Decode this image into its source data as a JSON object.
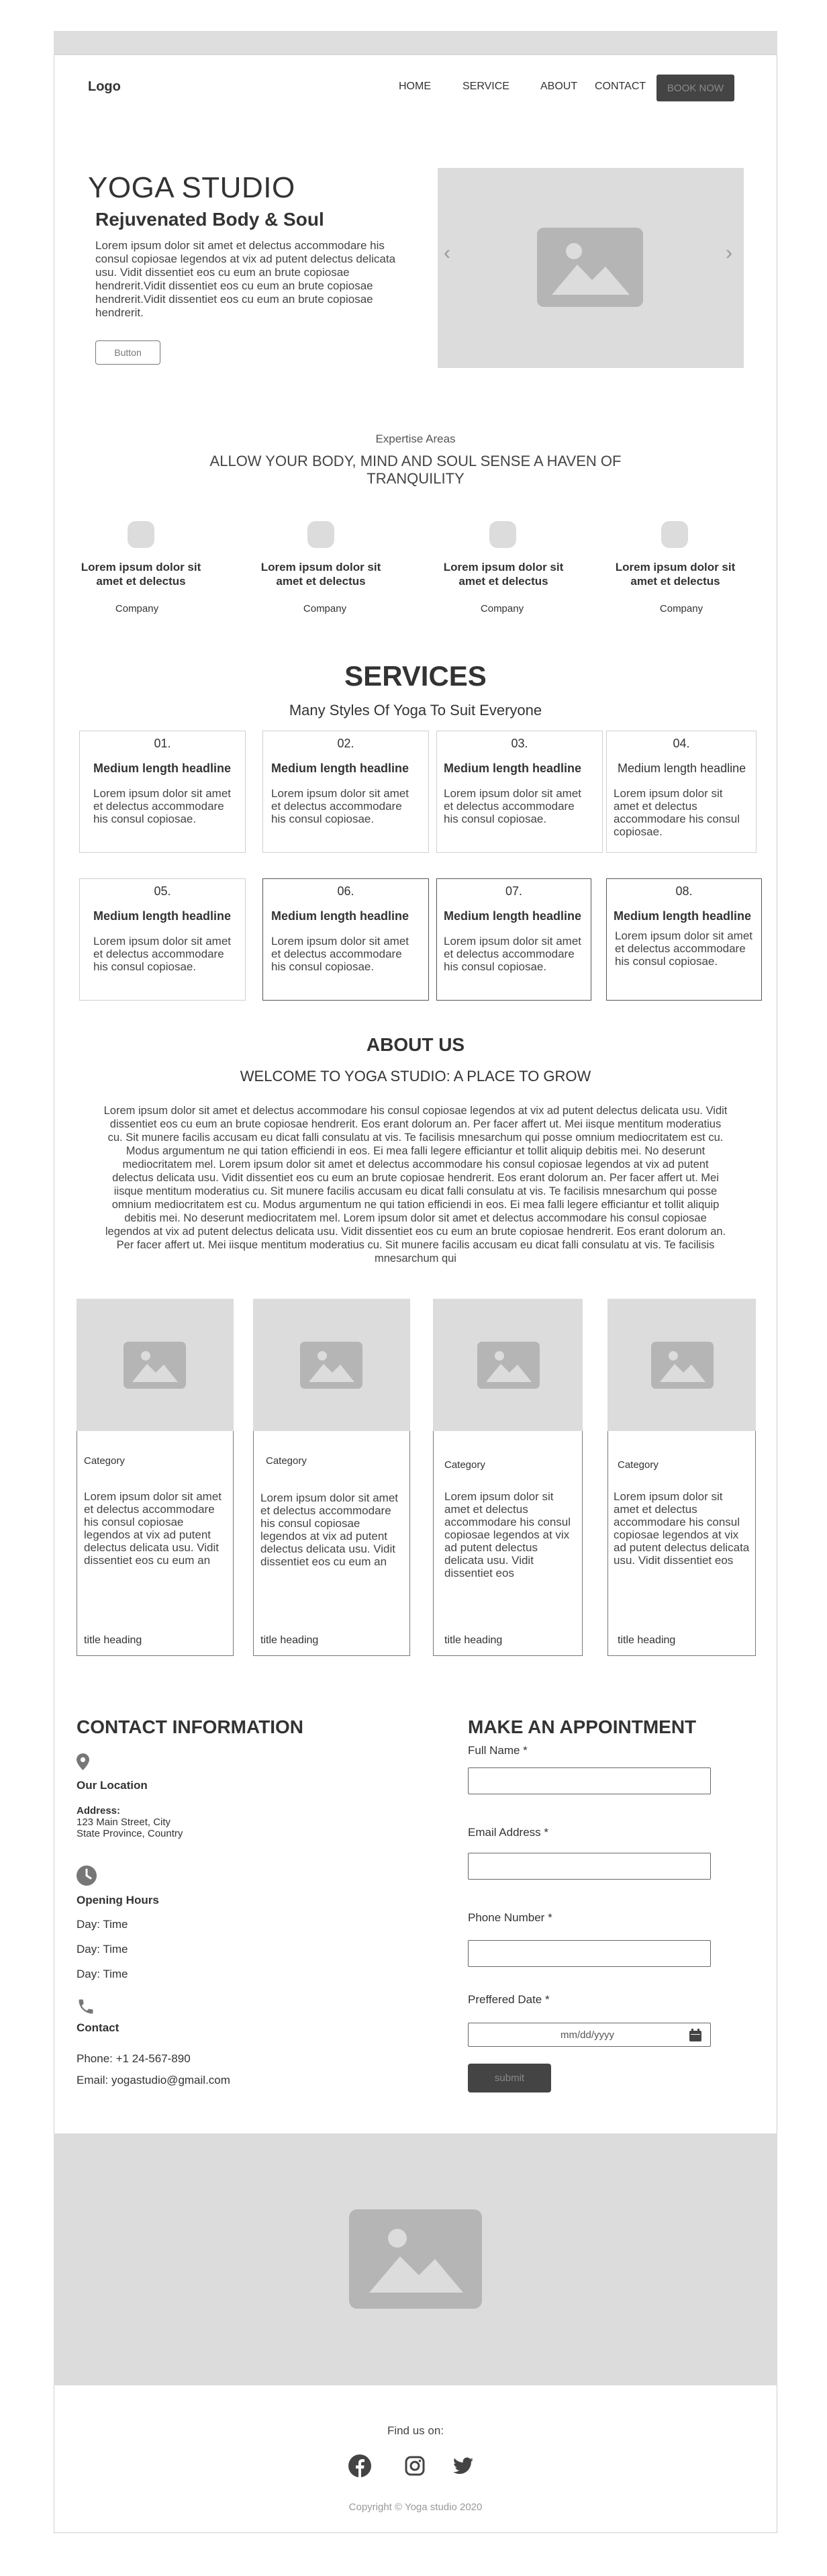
{
  "colors": {
    "placeholder_bg": "#dcdcdc",
    "placeholder_icon": "#b5b5b5",
    "button_dark": "#444444",
    "border": "#cfcfcf"
  },
  "nav": {
    "logo": "Logo",
    "items": [
      "HOME",
      "SERVICE",
      "ABOUT",
      "CONTACT"
    ],
    "cta": "BOOK NOW"
  },
  "hero": {
    "title": "YOGA STUDIO",
    "subtitle": "Rejuvenated Body & Soul",
    "text": "Lorem ipsum dolor sit amet et delectus accommodare his consul copiosae legendos at vix ad putent delectus delicata usu. Vidit dissentiet eos cu eum an brute copiosae hendrerit.Vidit dissentiet eos cu eum an brute copiosae hendrerit.Vidit dissentiet eos cu eum an brute copiosae hendrerit.",
    "button": "Button",
    "image_icon": "image-placeholder-icon",
    "prev_icon": "chevron-left-icon",
    "next_icon": "chevron-right-icon"
  },
  "expertise": {
    "kicker": "Expertise Areas",
    "title": "ALLOW YOUR BODY, MIND AND SOUL SENSE A HAVEN OF TRANQUILITY",
    "items": [
      {
        "label": "Lorem ipsum dolor sit amet et delectus",
        "company": "Company"
      },
      {
        "label": "Lorem ipsum dolor sit amet et delectus",
        "company": "Company"
      },
      {
        "label": "Lorem ipsum dolor sit amet et delectus",
        "company": "Company"
      },
      {
        "label": "Lorem ipsum dolor sit amet et delectus",
        "company": "Company"
      }
    ]
  },
  "services": {
    "title": "SERVICES",
    "subtitle": "Many Styles Of Yoga To Suit Everyone",
    "cards": [
      {
        "num": "01.",
        "heading": "Medium length headline",
        "text": "Lorem ipsum dolor sit amet et delectus accommodare his consul copiosae."
      },
      {
        "num": "02.",
        "heading": "Medium length headline",
        "text": "Lorem ipsum dolor sit amet et delectus accommodare his consul copiosae."
      },
      {
        "num": "03.",
        "heading": "Medium length headline",
        "text": "Lorem ipsum dolor sit amet et delectus accommodare his consul copiosae."
      },
      {
        "num": "04.",
        "heading": "Medium length headline",
        "text": "Lorem ipsum dolor sit amet et delectus accommodare his consul copiosae."
      },
      {
        "num": "05.",
        "heading": "Medium length headline",
        "text": "Lorem ipsum dolor sit amet et delectus accommodare his consul copiosae."
      },
      {
        "num": "06.",
        "heading": "Medium length headline",
        "text": "Lorem ipsum dolor sit amet et delectus accommodare his consul copiosae."
      },
      {
        "num": "07.",
        "heading": "Medium length headline",
        "text": "Lorem ipsum dolor sit amet et delectus accommodare his consul copiosae."
      },
      {
        "num": "08.",
        "heading": "Medium length headline",
        "text": "Lorem ipsum dolor sit amet et delectus accommodare his consul copiosae."
      }
    ]
  },
  "about": {
    "title": "ABOUT US",
    "subtitle": "WELCOME TO YOGA STUDIO: A PLACE TO GROW",
    "text": "Lorem ipsum dolor sit amet et delectus accommodare his consul copiosae legendos at vix ad putent delectus delicata usu. Vidit dissentiet eos cu eum an brute copiosae hendrerit. Eos erant dolorum an. Per facer affert ut. Mei iisque mentitum moderatius cu. Sit munere facilis accusam eu dicat falli consulatu at vis. Te facilisis mnesarchum qui posse omnium mediocritatem est cu. Modus argumentum ne qui tation efficiendi in eos. Ei mea falli legere efficiantur et tollit aliquip debitis mei. No deserunt mediocritatem mel. Lorem ipsum dolor sit amet et delectus accommodare his consul copiosae legendos at vix ad putent delectus delicata usu. Vidit dissentiet eos cu eum an brute copiosae hendrerit. Eos erant dolorum an. Per facer affert ut. Mei iisque mentitum moderatius cu. Sit munere facilis accusam eu dicat falli consulatu at vis. Te facilisis mnesarchum qui posse omnium mediocritatem est cu. Modus argumentum ne qui tation efficiendi in eos. Ei mea falli legere efficiantur et tollit aliquip debitis mei. No deserunt mediocritatem mel. Lorem ipsum dolor sit amet et delectus accommodare his consul copiosae legendos at vix ad putent delectus delicata usu. Vidit dissentiet eos cu eum an brute copiosae hendrerit. Eos erant dolorum an. Per facer affert ut. Mei iisque mentitum moderatius cu. Sit munere facilis accusam eu dicat falli consulatu at vis. Te facilisis mnesarchum qui",
    "cards": [
      {
        "category": "Category",
        "text": "Lorem ipsum dolor sit amet et delectus accommodare his consul copiosae legendos at vix ad putent delectus delicata usu. Vidit dissentiet eos cu eum an",
        "heading": "title heading"
      },
      {
        "category": "Category",
        "text": "Lorem ipsum dolor sit amet et delectus accommodare his consul copiosae legendos at vix ad putent delectus delicata usu. Vidit dissentiet eos cu eum an",
        "heading": "title heading"
      },
      {
        "category": "Category",
        "text": "Lorem ipsum dolor sit amet et delectus accommodare his consul copiosae legendos at vix ad putent delectus delicata usu. Vidit dissentiet eos",
        "heading": "title heading"
      },
      {
        "category": "Category",
        "text": "Lorem ipsum dolor sit amet et delectus accommodare his consul copiosae legendos at vix ad putent delectus delicata usu. Vidit dissentiet eos",
        "heading": "title heading"
      }
    ]
  },
  "contact": {
    "title": "CONTACT INFORMATION",
    "location_title": "Our Location",
    "address_label": "Address:",
    "address_line1": "123 Main Street, City",
    "address_line2": "State Province, Country",
    "hours_title": "Opening Hours",
    "hours": [
      "Day: Time",
      "Day: Time",
      "Day: Time"
    ],
    "contact_title": "Contact",
    "phone": "Phone: +1 24-567-890",
    "email": "Email: yogastudio@gmail.com"
  },
  "appointment": {
    "title": "MAKE AN APPOINTMENT",
    "full_name_label": "Full Name *",
    "email_label": "Email Address *",
    "phone_label": "Phone Number *",
    "date_label": "Preffered Date *",
    "date_placeholder": "mm/dd/yyyy",
    "submit": "submit"
  },
  "footer": {
    "find_us": "Find us on:",
    "social": [
      "facebook-icon",
      "instagram-icon",
      "twitter-icon"
    ],
    "copyright": "Copyright © Yoga studio 2020"
  }
}
